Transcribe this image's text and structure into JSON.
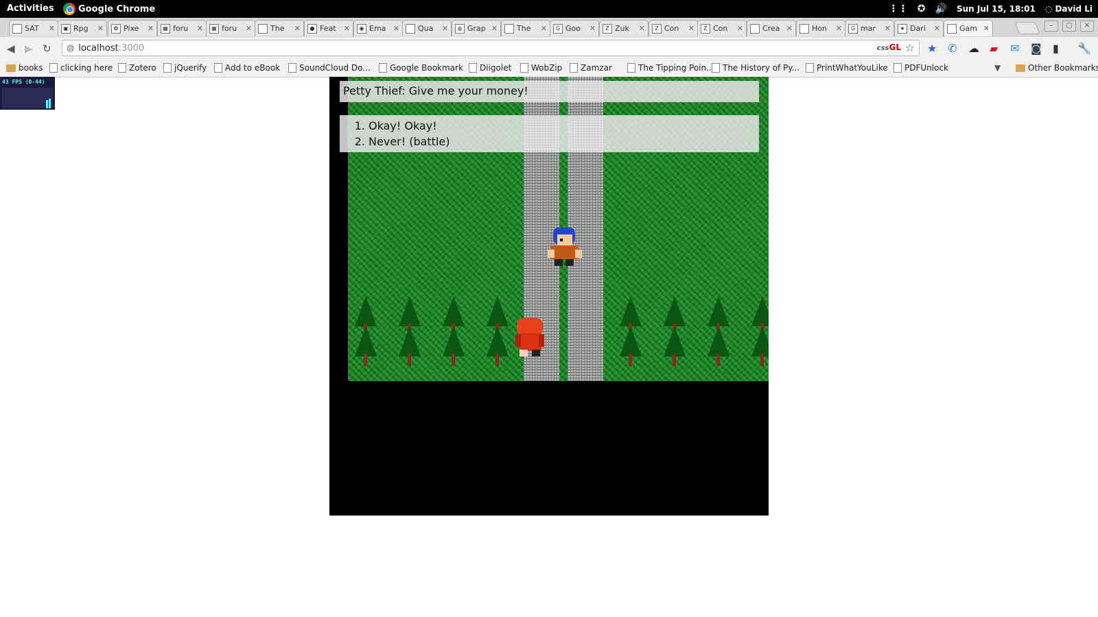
{
  "topbar": {
    "activities": "Activities",
    "app_name": "Google Chrome",
    "clock": "Sun Jul 15, 18:01",
    "user": "David Li"
  },
  "tabs": [
    {
      "title": "SAT",
      "icon": "page-icon"
    },
    {
      "title": "Rpg",
      "icon": "rpg-icon"
    },
    {
      "title": "Pixe",
      "icon": "pixel-icon"
    },
    {
      "title": "foru",
      "icon": "forum-icon"
    },
    {
      "title": "foru",
      "icon": "forum-icon"
    },
    {
      "title": "The",
      "icon": "blank-icon"
    },
    {
      "title": "Feat",
      "icon": "feature-icon"
    },
    {
      "title": "Ema",
      "icon": "email-icon"
    },
    {
      "title": "Qua",
      "icon": "page-icon"
    },
    {
      "title": "Grap",
      "icon": "globe-icon"
    },
    {
      "title": "The",
      "icon": "page-icon"
    },
    {
      "title": "Goo",
      "icon": "google-icon"
    },
    {
      "title": "Zuk",
      "icon": "z-icon"
    },
    {
      "title": "Con",
      "icon": "z-icon"
    },
    {
      "title": "Con",
      "icon": "z-icon"
    },
    {
      "title": "Crea",
      "icon": "page-icon"
    },
    {
      "title": "Hon",
      "icon": "page-icon"
    },
    {
      "title": "mar",
      "icon": "google-icon"
    },
    {
      "title": "Dari",
      "icon": "star-icon"
    },
    {
      "title": "Gam",
      "icon": "page-icon",
      "active": true
    }
  ],
  "omnibox": {
    "host": "localhost",
    "port": ":3000",
    "css": "css",
    "gl": "GL"
  },
  "bookmarks": [
    {
      "label": "books",
      "type": "folder"
    },
    {
      "label": "clicking here",
      "type": "page"
    },
    {
      "label": "Zotero",
      "type": "page"
    },
    {
      "label": "jQuerify",
      "type": "page"
    },
    {
      "label": "Add to eBook",
      "type": "page"
    },
    {
      "label": "SoundCloud Do...",
      "type": "page"
    },
    {
      "label": "Google Bookmark",
      "type": "page"
    },
    {
      "label": "Diigolet",
      "type": "page"
    },
    {
      "label": "WobZip",
      "type": "page"
    },
    {
      "label": "Zamzar",
      "type": "page"
    },
    {
      "label": "The Tipping Poin...",
      "type": "page"
    },
    {
      "label": "The History of Py...",
      "type": "page"
    },
    {
      "label": "PrintWhatYouLike",
      "type": "page"
    },
    {
      "label": "PDFUnlock",
      "type": "page"
    }
  ],
  "other_bookmarks": "Other Bookmarks",
  "fps": {
    "text": "43 FPS (0-44)"
  },
  "game": {
    "dialog": "Petty Thief: Give me your money!",
    "choices": [
      "Okay! Okay!",
      "Never! (battle)"
    ]
  },
  "colors": {
    "grass": "#1f8f2a",
    "road": "#b5b5b5",
    "tree": "#0b5514",
    "dialog_bg": "#e6e6e6"
  }
}
